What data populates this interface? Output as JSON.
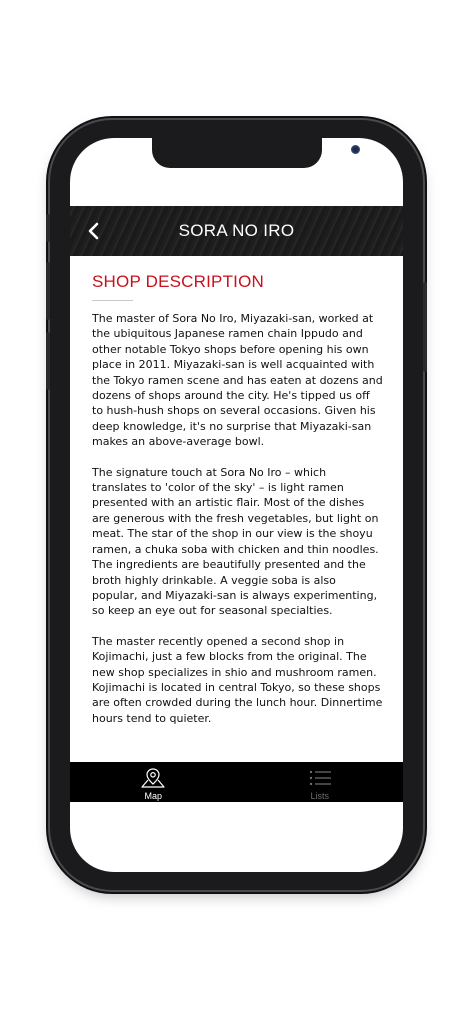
{
  "header": {
    "title": "SORA NO IRO",
    "back_icon": "chevron-left-icon"
  },
  "section": {
    "title": "SHOP DESCRIPTION"
  },
  "paragraphs": [
    "The master of Sora No Iro, Miyazaki-san, worked at the ubiquitous Japanese ramen chain Ippudo and other notable Tokyo shops before opening his own place in 2011. Miyazaki-san is well acquainted with the Tokyo ramen scene and has eaten at dozens and dozens of shops around the city. He's tipped us off to hush-hush shops on several occasions. Given his deep knowledge, it's no surprise that Miyazaki-san makes an above-average bowl.",
    "The signature touch at Sora No Iro – which translates to 'color of the sky' – is light ramen presented with an artistic flair. Most of the dishes are generous with the fresh vegetables, but light on meat. The star of the shop in our view is the shoyu ramen, a chuka soba with chicken and thin noodles. The ingredients are beautifully presented and the broth highly drinkable. A veggie soba is also popular, and Miyazaki-san is always experimenting, so keep an eye out for seasonal specialties.",
    "The master recently opened a second shop in Kojimachi, just a few blocks from the original. The new shop specializes in shio and mushroom ramen. Kojimachi is located in central Tokyo, so these shops are often crowded during the lunch hour. Dinnertime hours tend to quieter."
  ],
  "tabs": [
    {
      "label": "Map",
      "icon": "map-pin-icon",
      "active": true
    },
    {
      "label": "Lists",
      "icon": "list-icon",
      "active": false
    }
  ],
  "colors": {
    "accent": "#c8101e",
    "tabbar": "#000000",
    "phone_frame": "#1b1b1d"
  }
}
